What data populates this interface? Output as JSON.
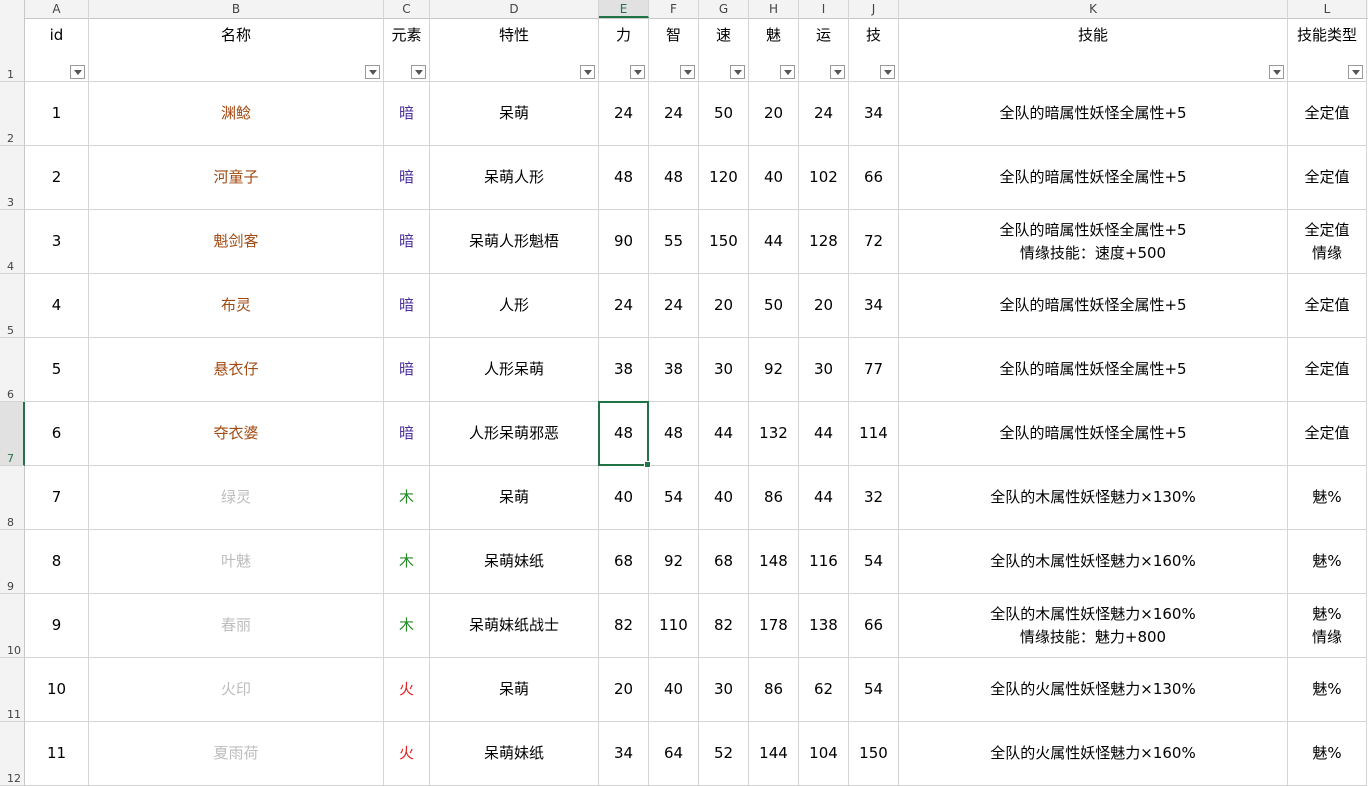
{
  "columns": [
    "A",
    "B",
    "C",
    "D",
    "E",
    "F",
    "G",
    "H",
    "I",
    "J",
    "K",
    "L"
  ],
  "active_column": "E",
  "row_numbers": [
    "1",
    "2",
    "3",
    "4",
    "5",
    "6",
    "7",
    "8",
    "9",
    "10",
    "11",
    "12"
  ],
  "active_row": "7",
  "headers": [
    "id",
    "名称",
    "元素",
    "特性",
    "力",
    "智",
    "速",
    "魅",
    "运",
    "技",
    "技能",
    "技能类型"
  ],
  "element_colors": {
    "暗": "#4b2d9a",
    "木": "#2a8a2a",
    "火": "#e02020"
  },
  "rows": [
    {
      "id": "1",
      "name": "渊鲶",
      "elem": "暗",
      "trait": "呆萌",
      "li": "24",
      "zhi": "24",
      "su": "50",
      "mei": "20",
      "yun": "24",
      "ji": "34",
      "skill": "全队的暗属性妖怪全属性+5",
      "type": "全定值",
      "tone": "dark"
    },
    {
      "id": "2",
      "name": "河童子",
      "elem": "暗",
      "trait": "呆萌人形",
      "li": "48",
      "zhi": "48",
      "su": "120",
      "mei": "40",
      "yun": "102",
      "ji": "66",
      "skill": "全队的暗属性妖怪全属性+5",
      "type": "全定值",
      "tone": "dark"
    },
    {
      "id": "3",
      "name": "魁剑客",
      "elem": "暗",
      "trait": "呆萌人形魁梧",
      "li": "90",
      "zhi": "55",
      "su": "150",
      "mei": "44",
      "yun": "128",
      "ji": "72",
      "skill": "全队的暗属性妖怪全属性+5\n情缘技能：速度+500",
      "type": "全定值\n情缘",
      "tone": "dark"
    },
    {
      "id": "4",
      "name": "布灵",
      "elem": "暗",
      "trait": "人形",
      "li": "24",
      "zhi": "24",
      "su": "20",
      "mei": "50",
      "yun": "20",
      "ji": "34",
      "skill": "全队的暗属性妖怪全属性+5",
      "type": "全定值",
      "tone": "dark"
    },
    {
      "id": "5",
      "name": "悬衣仔",
      "elem": "暗",
      "trait": "人形呆萌",
      "li": "38",
      "zhi": "38",
      "su": "30",
      "mei": "92",
      "yun": "30",
      "ji": "77",
      "skill": "全队的暗属性妖怪全属性+5",
      "type": "全定值",
      "tone": "dark"
    },
    {
      "id": "6",
      "name": "夺衣婆",
      "elem": "暗",
      "trait": "人形呆萌邪恶",
      "li": "48",
      "zhi": "48",
      "su": "44",
      "mei": "132",
      "yun": "44",
      "ji": "114",
      "skill": "全队的暗属性妖怪全属性+5",
      "type": "全定值",
      "tone": "dark"
    },
    {
      "id": "7",
      "name": "绿灵",
      "elem": "木",
      "trait": "呆萌",
      "li": "40",
      "zhi": "54",
      "su": "40",
      "mei": "86",
      "yun": "44",
      "ji": "32",
      "skill": "全队的木属性妖怪魅力×130%",
      "type": "魅%",
      "tone": "light"
    },
    {
      "id": "8",
      "name": "叶魅",
      "elem": "木",
      "trait": "呆萌妹纸",
      "li": "68",
      "zhi": "92",
      "su": "68",
      "mei": "148",
      "yun": "116",
      "ji": "54",
      "skill": "全队的木属性妖怪魅力×160%",
      "type": "魅%",
      "tone": "light"
    },
    {
      "id": "9",
      "name": "春丽",
      "elem": "木",
      "trait": "呆萌妹纸战士",
      "li": "82",
      "zhi": "110",
      "su": "82",
      "mei": "178",
      "yun": "138",
      "ji": "66",
      "skill": "全队的木属性妖怪魅力×160%\n情缘技能：魅力+800",
      "type": "魅%\n情缘",
      "tone": "light"
    },
    {
      "id": "10",
      "name": "火印",
      "elem": "火",
      "trait": "呆萌",
      "li": "20",
      "zhi": "40",
      "su": "30",
      "mei": "86",
      "yun": "62",
      "ji": "54",
      "skill": "全队的火属性妖怪魅力×130%",
      "type": "魅%",
      "tone": "light"
    },
    {
      "id": "11",
      "name": "夏雨荷",
      "elem": "火",
      "trait": "呆萌妹纸",
      "li": "34",
      "zhi": "64",
      "su": "52",
      "mei": "144",
      "yun": "104",
      "ji": "150",
      "skill": "全队的火属性妖怪魅力×160%",
      "type": "魅%",
      "tone": "light"
    }
  ]
}
